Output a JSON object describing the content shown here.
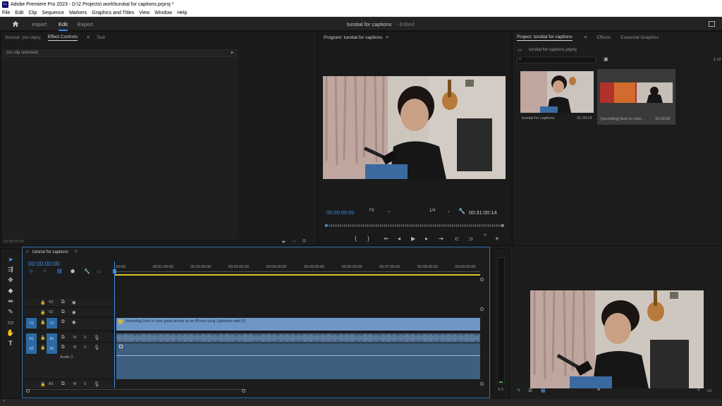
{
  "titlebar": {
    "logo": "Pr",
    "title": "Adobe Premiere Pro 2023 - D:\\2 Projects\\.work\\turotial for captions.prproj *"
  },
  "menu": [
    "File",
    "Edit",
    "Clip",
    "Sequence",
    "Markers",
    "Graphics and Titles",
    "View",
    "Window",
    "Help"
  ],
  "workspace": {
    "tabs": [
      "Import",
      "Edit",
      "Export"
    ],
    "active": "Edit",
    "project_name": "turotial for captions",
    "status": "- Edited"
  },
  "source_panel": {
    "tabs": [
      "Source: (no clips)",
      "Effect Controls",
      "Text"
    ],
    "active": "Effect Controls",
    "no_clip": "(no clip selected)",
    "timecode": "00:00:00:00"
  },
  "program_monitor": {
    "title": "Program: turotial for captions",
    "timecode": "00:00:00:00",
    "fit": "Fit",
    "resolution": "1/4",
    "duration": "00:31:00:14"
  },
  "project_panel": {
    "tabs": [
      "Project: turotial for captions",
      "Effects",
      "Essential Graphics"
    ],
    "file": "turotial for captions.prproj",
    "count": "1 of",
    "items": [
      {
        "name": "turotial for captions",
        "duration": "31:00:14"
      },
      {
        "name": "[recording] How to color...",
        "duration": "31:00:35"
      }
    ]
  },
  "timeline": {
    "sequence_name": "tutorial for captions",
    "timecode": "00:00:00:00",
    "ruler": [
      ":00:00",
      "00:01:00:00",
      "00:02:00:00",
      "00:03:00:00",
      "00:04:00:00",
      "00:05:00:00",
      "00:06:00:00",
      "00:07:00:00",
      "00:08:00:00",
      "00:09:00:00"
    ],
    "video_tracks": [
      "V3",
      "V2",
      "V1"
    ],
    "audio_tracks": [
      "A1",
      "A2",
      "A3"
    ],
    "source_targets": [
      "V1",
      "A1",
      "A2"
    ],
    "clip_label": "[recording] How to color grade photos on an iPhone using Lightroom.mp4 [V]",
    "audio2_label": "Audio 2",
    "track_letters": {
      "m": "M",
      "s": "S"
    },
    "meter_label": "S S"
  },
  "colors": {
    "accent": "#2d8ceb",
    "video_clip": "#6e97c6",
    "audio_clip": "#3f5f80",
    "playhead": "#3a8ee6"
  }
}
